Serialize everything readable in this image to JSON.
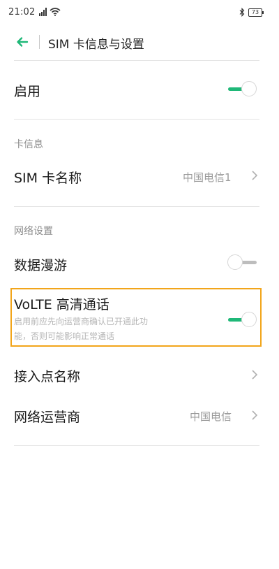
{
  "status_bar": {
    "time": "21:02",
    "battery": "73",
    "icons": [
      "signal-icon",
      "wifi-icon",
      "bluetooth-icon",
      "battery-icon"
    ]
  },
  "header": {
    "title": "SIM 卡信息与设置",
    "back_icon": "arrow-left-icon"
  },
  "enable_row": {
    "label": "启用",
    "toggle_on": true
  },
  "card_info_section": {
    "heading": "卡信息",
    "sim_name_label": "SIM 卡名称",
    "sim_name_value": "中国电信1"
  },
  "network_section": {
    "heading": "网络设置",
    "data_roaming_label": "数据漫游",
    "data_roaming_on": false,
    "volte": {
      "label": "VoLTE 高清通话",
      "description_line1": "启用前应先向运营商确认已开通此功",
      "description_line2": "能，否则可能影响正常通话",
      "toggle_on": true
    },
    "apn_label": "接入点名称",
    "operator_label": "网络运营商",
    "operator_value": "中国电信"
  },
  "colors": {
    "accent": "#1fb878",
    "highlight": "#f2a51a",
    "secondary_text": "#9a9a9a"
  }
}
